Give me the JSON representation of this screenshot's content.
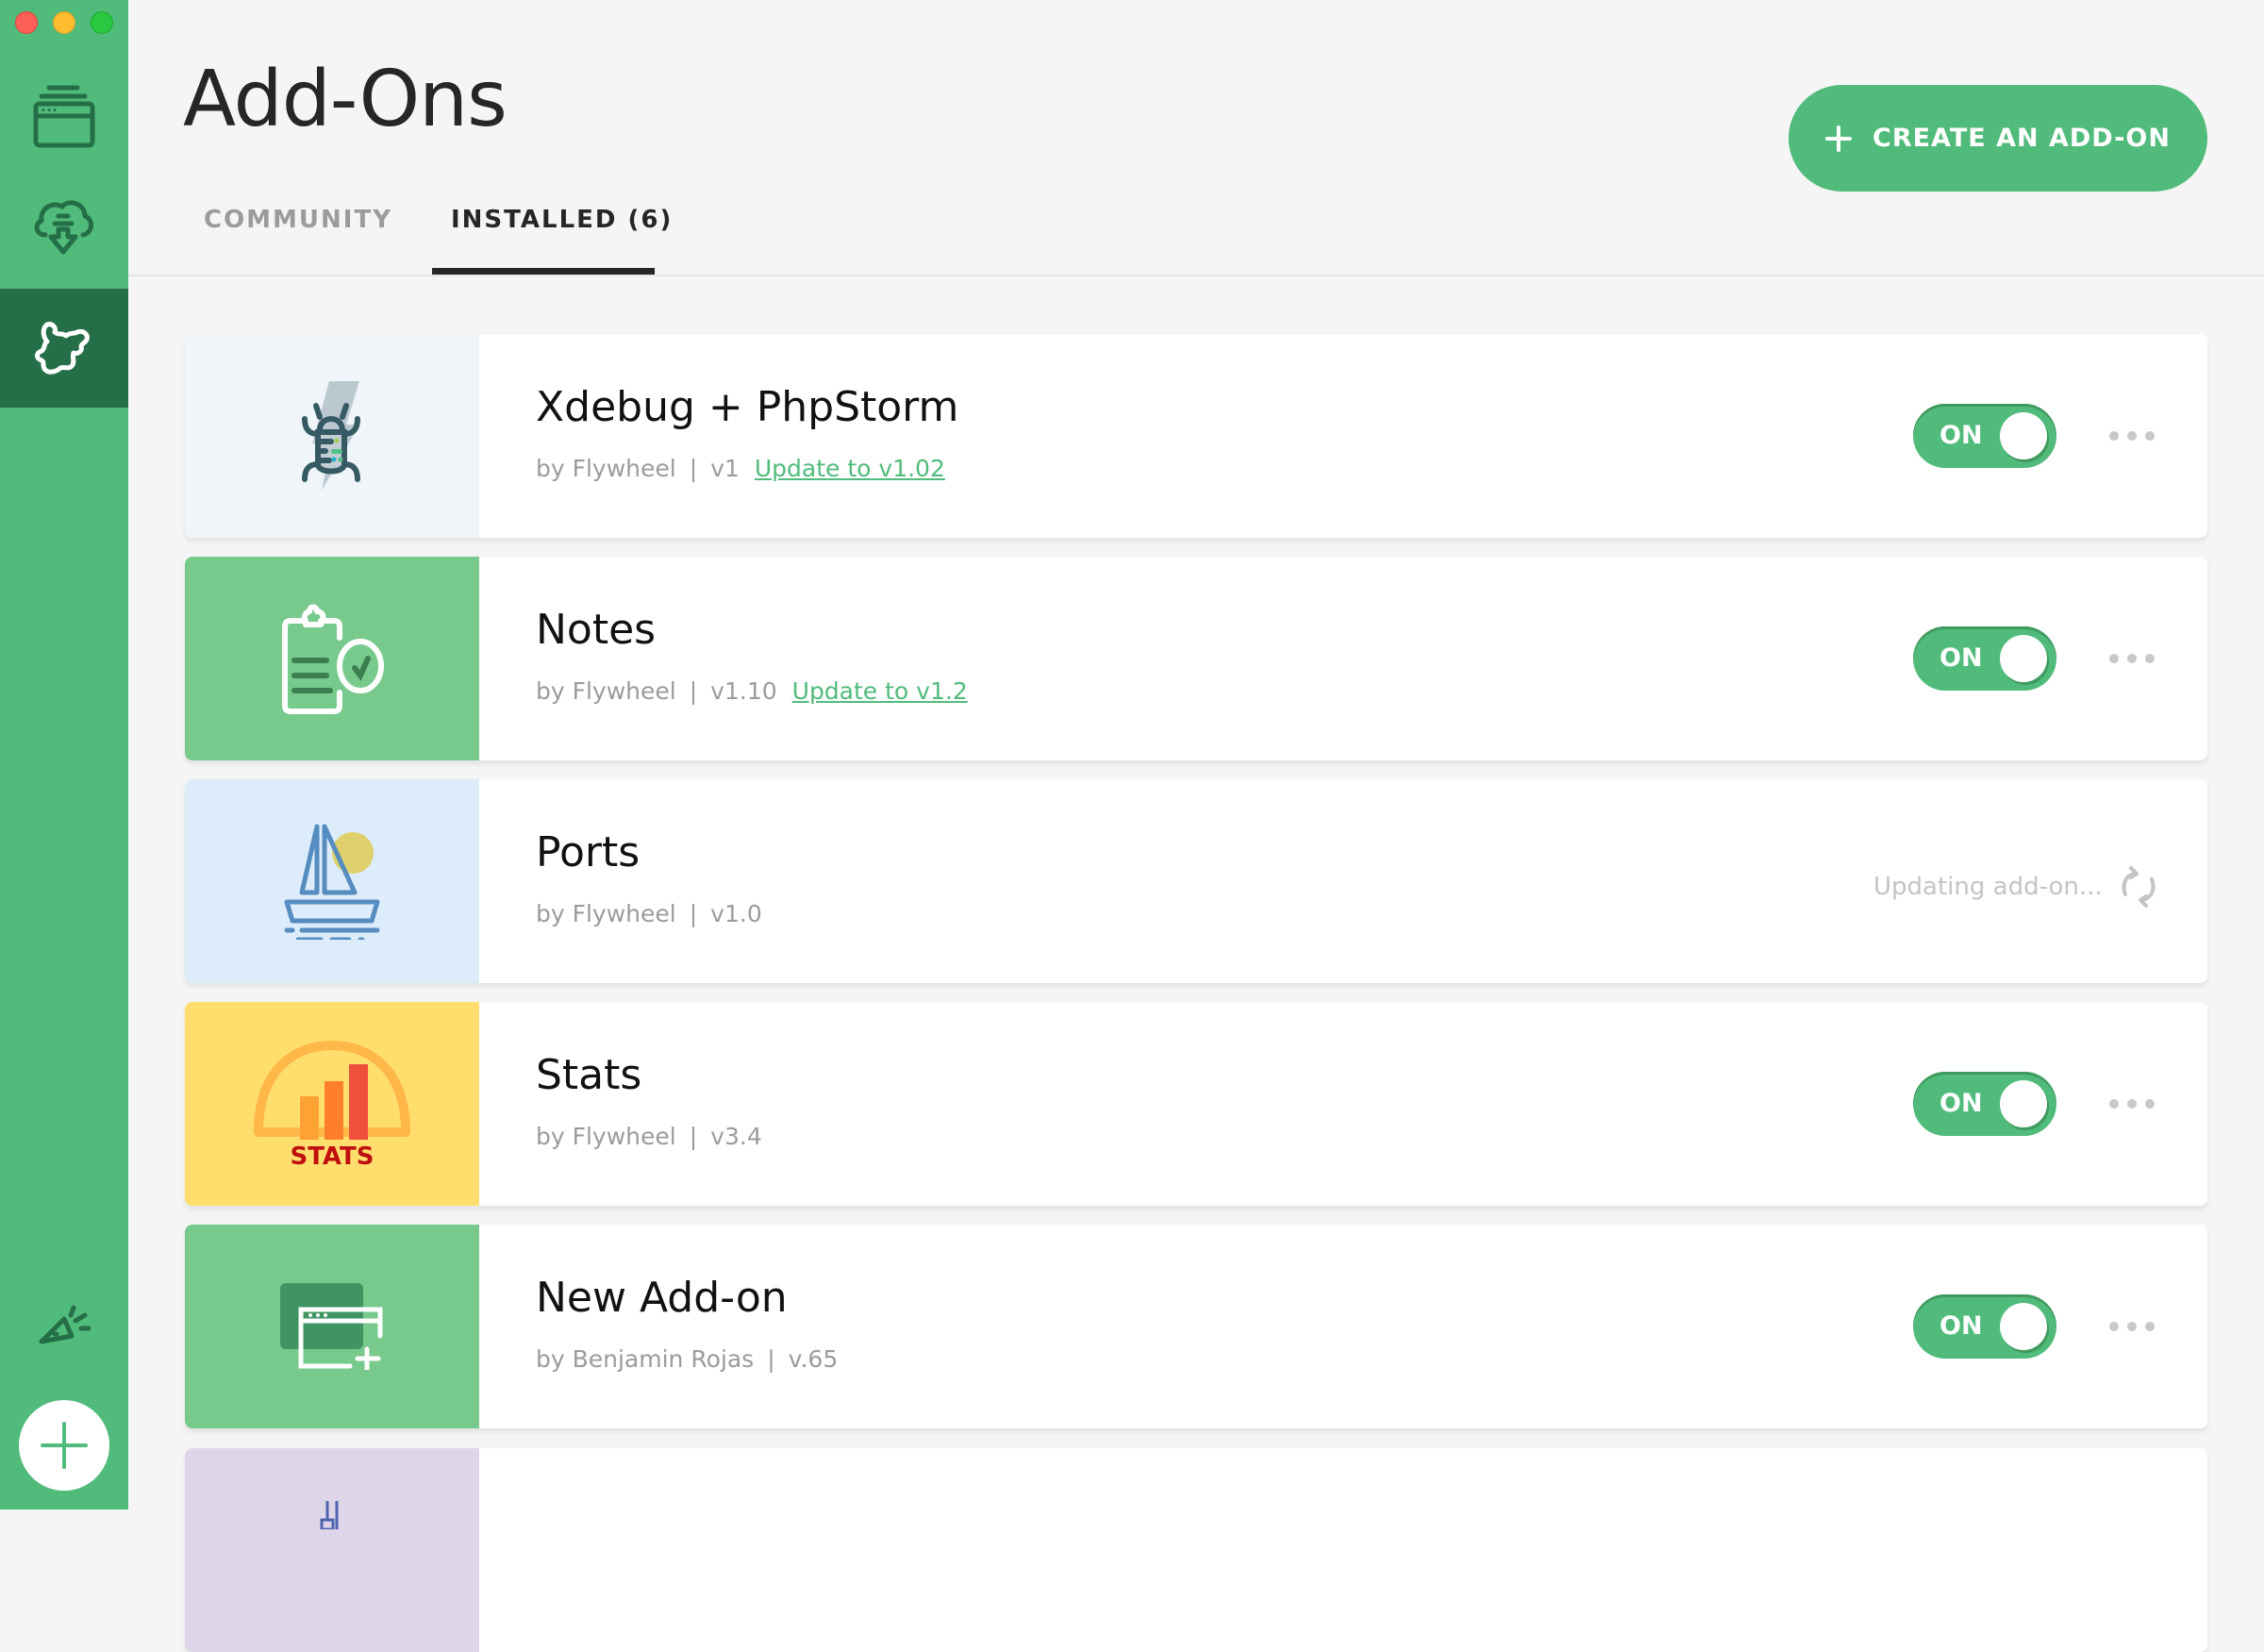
{
  "window": {
    "controls": [
      "close",
      "minimize",
      "maximize"
    ]
  },
  "sidebar": {
    "items": [
      {
        "name": "sites",
        "icon": "browser-window-icon",
        "active": false
      },
      {
        "name": "connect",
        "icon": "cloud-download-icon",
        "active": false
      },
      {
        "name": "add-ons",
        "icon": "puzzle-piece-icon",
        "active": true
      }
    ],
    "bottom": [
      {
        "name": "news",
        "icon": "megaphone-icon"
      },
      {
        "name": "add-site",
        "icon": "plus-icon"
      }
    ]
  },
  "header": {
    "title": "Add-Ons",
    "tabs": [
      {
        "label": "COMMUNITY",
        "active": false
      },
      {
        "label": "INSTALLED (6)",
        "active": true
      }
    ],
    "create_button": "CREATE AN ADD-ON"
  },
  "colors": {
    "accent": "#51bb7b",
    "sidebar_active": "#256f48",
    "text": "#262626",
    "muted": "#9b9b9b"
  },
  "addons": [
    {
      "title": "Xdebug + PhpStorm",
      "author": "by Flywheel",
      "version": "v1",
      "update": "Update to v1.02",
      "state": "toggle",
      "toggle_label": "ON",
      "icon": "bug-lightning-icon",
      "tile_color": "#f0f5fa"
    },
    {
      "title": "Notes",
      "author": "by Flywheel",
      "version": "v1.10",
      "update": "Update to v1.2",
      "state": "toggle",
      "toggle_label": "ON",
      "icon": "clipboard-check-icon",
      "tile_color": "#78c98c"
    },
    {
      "title": "Ports",
      "author": "by Flywheel",
      "version": "v1.0",
      "update": "",
      "state": "updating",
      "status_text": "Updating add-on...",
      "icon": "sailboat-icon",
      "tile_color": "#ddecfa"
    },
    {
      "title": "Stats",
      "author": "by Flywheel",
      "version": "v3.4",
      "update": "",
      "state": "toggle",
      "toggle_label": "ON",
      "icon": "stats-chart-icon",
      "tile_color": "#ffde6e",
      "icon_label": "STATS"
    },
    {
      "title": "New Add-on",
      "author": "by Benjamin Rojas",
      "version": "v.65",
      "update": "",
      "state": "toggle",
      "toggle_label": "ON",
      "icon": "new-window-icon",
      "tile_color": "#78c98c"
    },
    {
      "title": "",
      "author": "",
      "version": "",
      "update": "",
      "state": "",
      "icon": "pipe-icon",
      "tile_color": "#ded6e8"
    }
  ]
}
